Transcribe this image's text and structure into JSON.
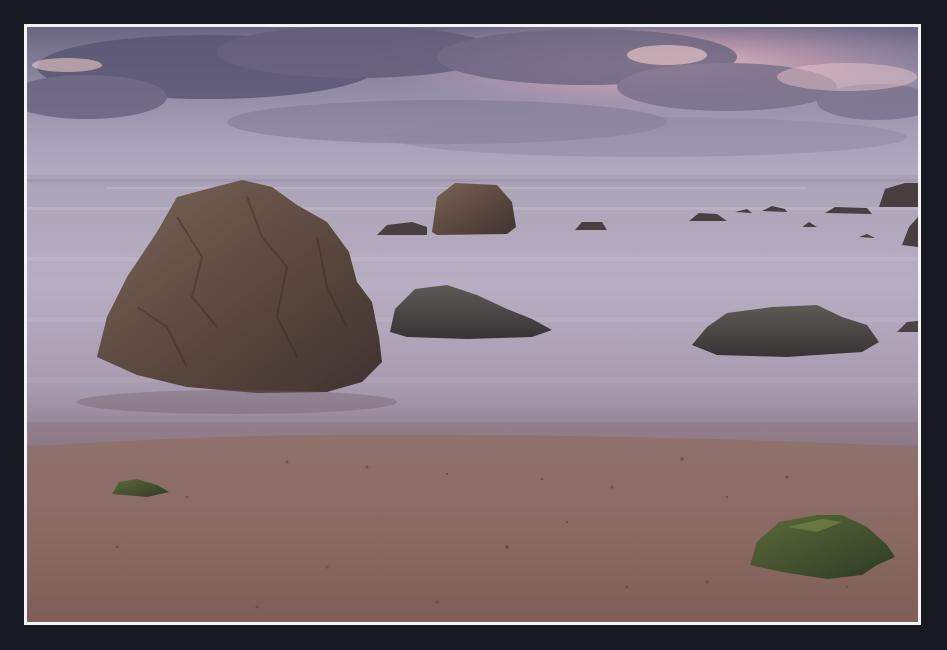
{
  "image": {
    "subject": "",
    "palette": {
      "frame": "#171a22",
      "border": "#f4f4f4",
      "sky_top": "#6f6982",
      "sky_glow": "#e8b9c4",
      "sea": "#b9aec4",
      "sand": "#8c6a63",
      "rock": "#5a4840",
      "moss": "#3e4f2c"
    }
  }
}
